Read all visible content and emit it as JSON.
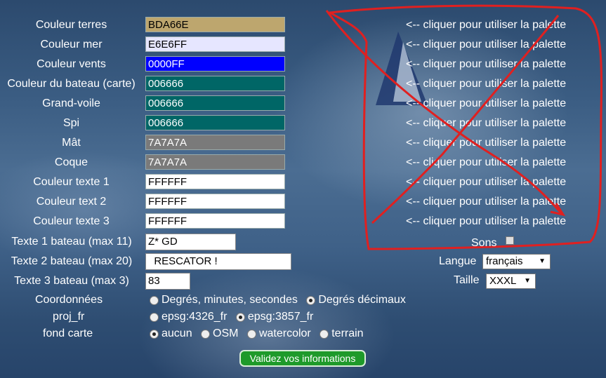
{
  "colors": [
    {
      "label": "Couleur terres",
      "value": "BDA66E",
      "bg": "#bda66e",
      "dark": true
    },
    {
      "label": "Couleur mer",
      "value": "E6E6FF",
      "bg": "#e6e6ff",
      "dark": true
    },
    {
      "label": "Couleur vents",
      "value": "0000FF",
      "bg": "#0000ff",
      "dark": false
    },
    {
      "label": "Couleur du bateau (carte)",
      "value": "006666",
      "bg": "#006666",
      "dark": false
    },
    {
      "label": "Grand-voile",
      "value": "006666",
      "bg": "#006666",
      "dark": false
    },
    {
      "label": "Spi",
      "value": "006666",
      "bg": "#006666",
      "dark": false
    },
    {
      "label": "Mât",
      "value": "7A7A7A",
      "bg": "#7a7a7a",
      "dark": false
    },
    {
      "label": "Coque",
      "value": "7A7A7A",
      "bg": "#7a7a7a",
      "dark": false
    },
    {
      "label": "Couleur texte 1",
      "value": "FFFFFF",
      "bg": "#ffffff",
      "dark": true
    },
    {
      "label": "Couleur text 2",
      "value": "FFFFFF",
      "bg": "#ffffff",
      "dark": true
    },
    {
      "label": "Couleur texte 3",
      "value": "FFFFFF",
      "bg": "#ffffff",
      "dark": true
    }
  ],
  "palette_link": "<-- cliquer pour utiliser la palette",
  "texts": [
    {
      "label": "Texte 1 bateau (max 11)",
      "value": "Z* GD"
    },
    {
      "label": "Texte 2 bateau (max 20)",
      "value": "  RESCATOR !"
    },
    {
      "label": "Texte 3 bateau (max 3)",
      "value": "83"
    }
  ],
  "sons_label": "Sons",
  "langue": {
    "label": "Langue",
    "value": "français"
  },
  "taille": {
    "label": "Taille",
    "value": "XXXL"
  },
  "coordonnees": {
    "label": "Coordonnées",
    "opt1": "Degrés, minutes, secondes",
    "opt2": "Degrés décimaux"
  },
  "proj": {
    "label": "proj_fr",
    "opt1": "epsg:4326_fr",
    "opt2": "epsg:3857_fr"
  },
  "fond": {
    "label": "fond carte",
    "opt1": "aucun",
    "opt2": "OSM",
    "opt3": "watercolor",
    "opt4": "terrain"
  },
  "submit_label": "Validez vos informations",
  "accent": "#e02020"
}
